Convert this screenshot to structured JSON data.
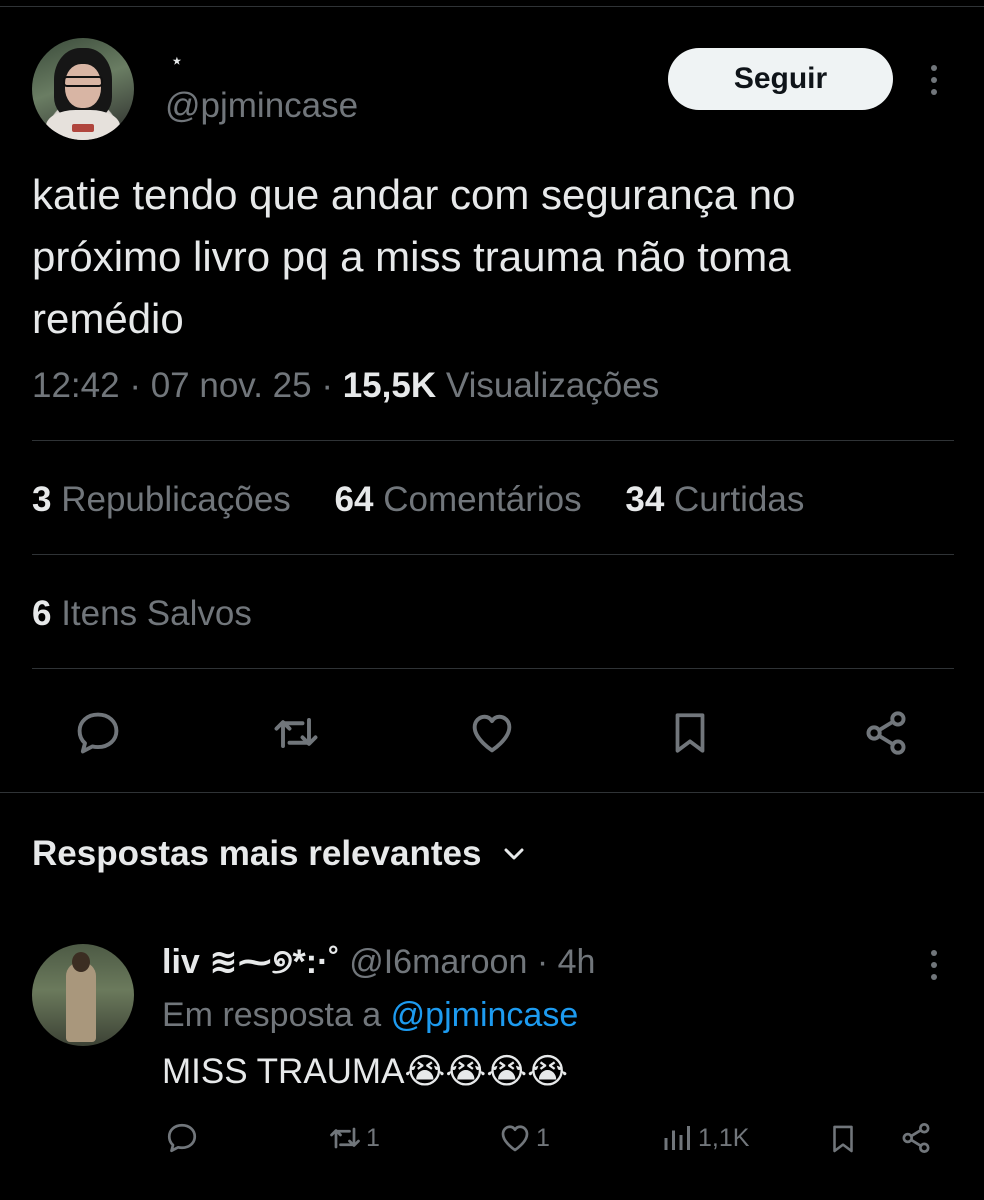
{
  "post": {
    "display_name": "⋆",
    "handle": "@pjmincase",
    "follow_label": "Seguir",
    "text": "katie tendo que andar com segurança no próximo livro pq a miss trauma não toma remédio",
    "time": "12:42",
    "date": "07 nov. 25",
    "views_count": "15,5K",
    "views_label": "Visualizações",
    "sep": "·"
  },
  "stats": {
    "reposts_count": "3",
    "reposts_label": "Republicações",
    "comments_count": "64",
    "comments_label": "Comentários",
    "likes_count": "34",
    "likes_label": "Curtidas",
    "saved_count": "6",
    "saved_label": "Itens Salvos"
  },
  "section": {
    "title": "Respostas mais relevantes"
  },
  "reply": {
    "name": "liv ≋⁓୭*:·˚",
    "handle": "@I6maroon",
    "time": "· 4h",
    "in_reply_prefix": "Em resposta a",
    "in_reply_handle": "@pjmincase",
    "text": "MISS TRAUMA😭😭😭😭",
    "reposts": "1",
    "likes": "1",
    "views": "1,1K"
  },
  "colors": {
    "background": "#000000",
    "text": "#e7e9ea",
    "muted": "#71767b",
    "link": "#1d9bf0",
    "divider": "#2f3336"
  },
  "icons": [
    "comment-icon",
    "repost-icon",
    "heart-icon",
    "bookmark-icon",
    "share-icon",
    "views-icon",
    "chevron-down-icon",
    "more-icon"
  ]
}
